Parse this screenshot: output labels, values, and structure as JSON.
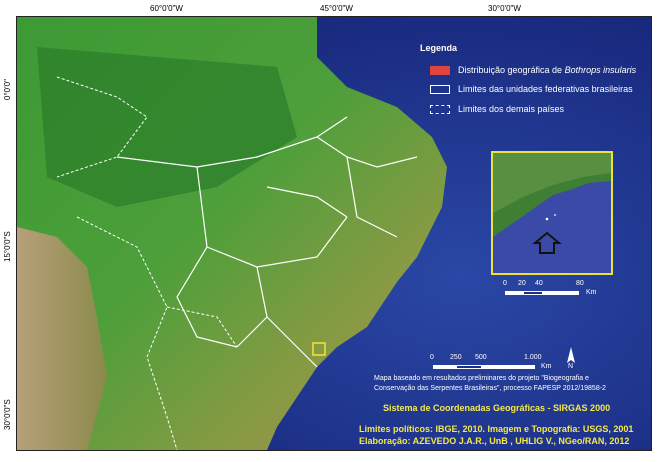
{
  "axes": {
    "longitudes": [
      "60°0'0\"W",
      "45°0'0\"W",
      "30°0'0\"W"
    ],
    "latitudes": [
      "0°0'0\"",
      "15°0'0\"S",
      "30°0'0\"S"
    ]
  },
  "legend": {
    "title": "Legenda",
    "items": [
      {
        "label_prefix": "Distribuição geográfica de ",
        "label_italic": "Bothrops insularis",
        "style": "fill",
        "color": "#e0443f"
      },
      {
        "label": "Limites das unidades federativas brasileiras",
        "style": "solid",
        "color": "#ffffff"
      },
      {
        "label": "Limites dos demais países",
        "style": "dashed",
        "color": "#ffffff"
      }
    ]
  },
  "inset_scale": {
    "ticks": [
      "0",
      "20",
      "40",
      "80"
    ],
    "unit": "Km"
  },
  "main_scale": {
    "ticks": [
      "0",
      "250",
      "500",
      "1.000"
    ],
    "unit": "Km"
  },
  "north_arrow": "N",
  "note": {
    "line1": "Mapa baseado em resultados preliminares do projeto \"Biogeografia e",
    "line2": "Conservação das Serpentes Brasileiras\", processo FAPESP 2012/19858-2"
  },
  "coordinate_system": "Sistema de Coordenadas Geográficas - SIRGAS 2000",
  "credits": {
    "line1": "Limites políticos: IBGE, 2010. Imagem e Topografia: USGS, 2001",
    "line2": "Elaboração: AZEVEDO J.A.R., UnB , UHLIG V., NGeo/RAN, 2012"
  },
  "colors": {
    "ocean": "#1d2f8c",
    "forest": "#2f8a2f",
    "highlight_box": "#e8e23a",
    "credit_text": "#f5e94a"
  }
}
